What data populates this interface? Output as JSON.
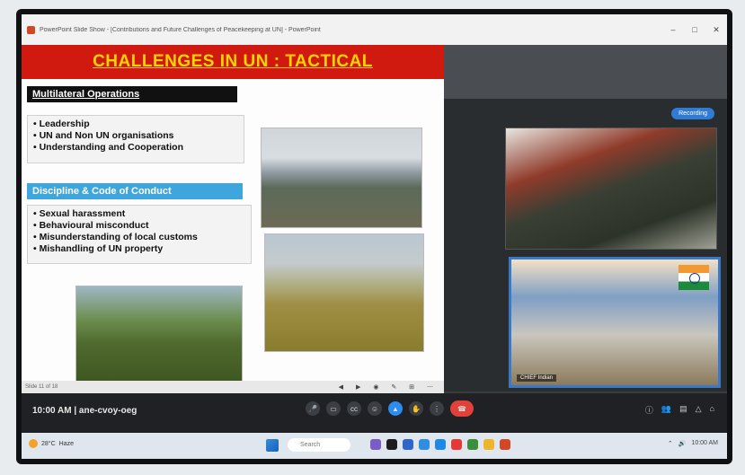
{
  "window": {
    "title": "PowerPoint Slide Show - [Contributions and Future Challenges of Peacekeeping at UN] - PowerPoint",
    "controls": [
      "–",
      "□",
      "✕"
    ]
  },
  "slide": {
    "title": "CHALLENGES IN UN : TACTICAL",
    "sections": [
      {
        "heading": "Multilateral Operations",
        "bullets": [
          "Leadership",
          "UN and Non UN organisations",
          "Understanding and Cooperation"
        ]
      },
      {
        "heading": "Discipline & Code of Conduct",
        "bullets": [
          "Sexual harassment",
          "Behavioural misconduct",
          "Misunderstanding of local customs",
          "Mishandling of UN property"
        ]
      }
    ],
    "status_text": "Slide 11 of 18"
  },
  "meeting": {
    "recording_pill": "Recording",
    "participant_name": "CHIEF Indian",
    "time": "10:00 AM",
    "meeting_code": "ane-cvoy-oeg",
    "accent": "#2d8cf0",
    "end_call_color": "#e0413a"
  },
  "taskbar": {
    "weather_temp": "28°C",
    "weather_label": "Haze",
    "search_placeholder": "Search",
    "clock": "10:00 AM"
  }
}
